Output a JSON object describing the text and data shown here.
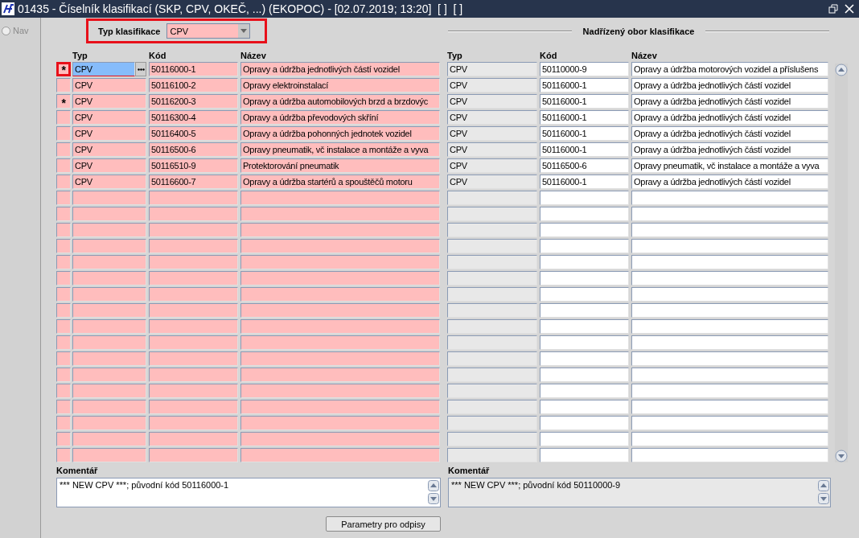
{
  "window": {
    "title": "01435 - Číselník klasifikací (SKP, CPV, OKEČ, ...) (EKOPOC) - [02.07.2019; 13:20]  [ ]  [ ]"
  },
  "nav": {
    "label": "Nav",
    "selected": false
  },
  "filter": {
    "label": "Typ klasifikace",
    "value": "CPV",
    "highlighted": true
  },
  "left_table": {
    "columns": [
      "Typ",
      "Kód",
      "Název"
    ],
    "rows": [
      {
        "marker": "*",
        "highlighted": true,
        "selected": true,
        "typ": "CPV",
        "kod": "50116000-1",
        "nazev": "Opravy a údržba jednotlivých částí vozidel"
      },
      {
        "highlighted": false,
        "selected": false,
        "typ": "CPV",
        "kod": "50116100-2",
        "nazev": "Opravy elektroinstalací"
      },
      {
        "marker": "*",
        "highlighted": false,
        "selected": false,
        "typ": "CPV",
        "kod": "50116200-3",
        "nazev": "Opravy a údržba automobilových brzd a brzdovýc"
      },
      {
        "highlighted": false,
        "selected": false,
        "typ": "CPV",
        "kod": "50116300-4",
        "nazev": "Opravy a údržba převodových skříní"
      },
      {
        "highlighted": false,
        "selected": false,
        "typ": "CPV",
        "kod": "50116400-5",
        "nazev": "Opravy a údržba pohonných jednotek vozidel"
      },
      {
        "highlighted": false,
        "selected": false,
        "typ": "CPV",
        "kod": "50116500-6",
        "nazev": "Opravy pneumatik, vč instalace a montáže a vyva"
      },
      {
        "highlighted": false,
        "selected": false,
        "typ": "CPV",
        "kod": "50116510-9",
        "nazev": "Protektorování pneumatik"
      },
      {
        "highlighted": false,
        "selected": false,
        "typ": "CPV",
        "kod": "50116600-7",
        "nazev": "Opravy a údržba startérů a spouštěčů motoru"
      }
    ]
  },
  "right_table": {
    "title": "Nadřízený obor klasifikace",
    "columns": [
      "Typ",
      "Kód",
      "Název"
    ],
    "rows": [
      {
        "typ": "CPV",
        "kod": "50110000-9",
        "nazev": "Opravy a údržba motorových vozidel a příslušens"
      },
      {
        "typ": "CPV",
        "kod": "50116000-1",
        "nazev": "Opravy a údržba jednotlivých částí vozidel"
      },
      {
        "typ": "CPV",
        "kod": "50116000-1",
        "nazev": "Opravy a údržba jednotlivých částí vozidel"
      },
      {
        "typ": "CPV",
        "kod": "50116000-1",
        "nazev": "Opravy a údržba jednotlivých částí vozidel"
      },
      {
        "typ": "CPV",
        "kod": "50116000-1",
        "nazev": "Opravy a údržba jednotlivých částí vozidel"
      },
      {
        "typ": "CPV",
        "kod": "50116000-1",
        "nazev": "Opravy a údržba jednotlivých částí vozidel"
      },
      {
        "typ": "CPV",
        "kod": "50116500-6",
        "nazev": "Opravy pneumatik, vč instalace a montáže a vyva"
      },
      {
        "typ": "CPV",
        "kod": "50116000-1",
        "nazev": "Opravy a údržba jednotlivých částí vozidel"
      }
    ]
  },
  "left_comment": {
    "label": "Komentář",
    "value": "*** NEW CPV ***; původní kód 50116000-1"
  },
  "right_comment": {
    "label": "Komentář",
    "value": "*** NEW CPV ***; původní kód 50110000-9"
  },
  "button": "Parametry pro odpisy"
}
